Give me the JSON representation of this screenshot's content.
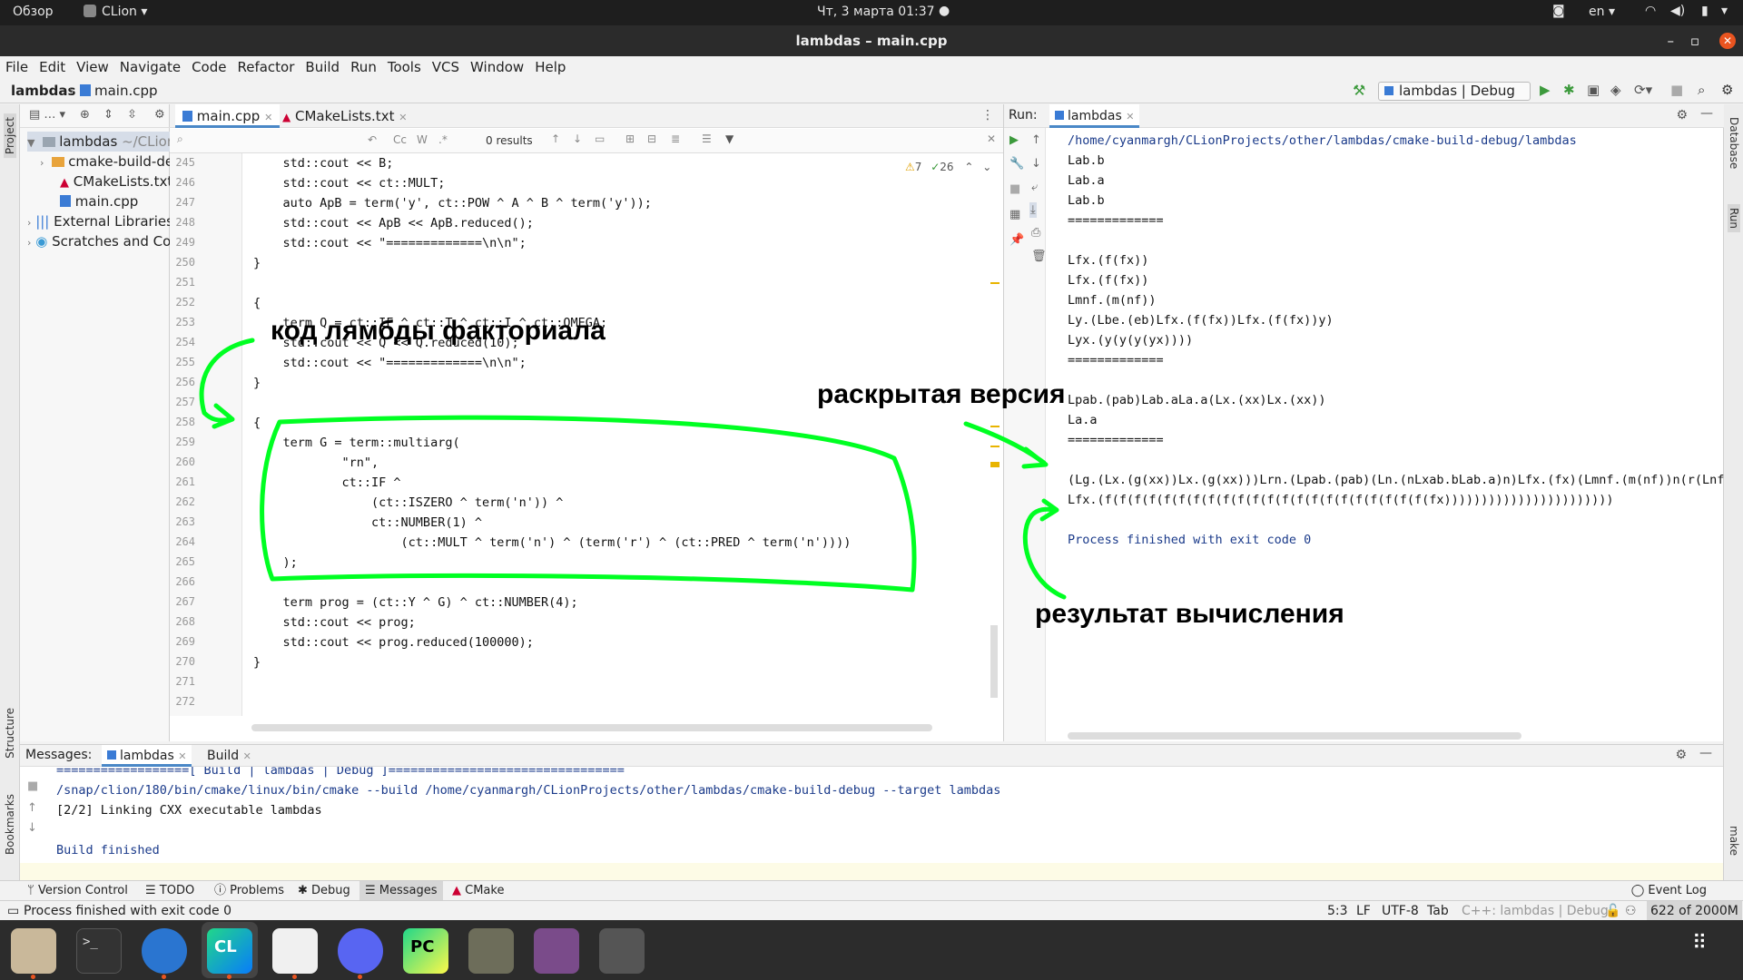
{
  "topbar": {
    "overview": "Обзор",
    "app": "CLion",
    "datetime": "Чт, 3 марта  01:37",
    "lang": "en"
  },
  "window": {
    "title": "lambdas – main.cpp"
  },
  "menu": [
    "File",
    "Edit",
    "View",
    "Navigate",
    "Code",
    "Refactor",
    "Build",
    "Run",
    "Tools",
    "VCS",
    "Window",
    "Help"
  ],
  "breadcrumb": {
    "project": "lambdas",
    "file": "main.cpp"
  },
  "run_config": "lambdas | Debug",
  "project_tree": [
    {
      "label": "lambdas",
      "suffix": "~/CLion",
      "indent": 0,
      "icon": "folder"
    },
    {
      "label": "cmake-build-de",
      "indent": 1,
      "icon": "folder-orange"
    },
    {
      "label": "CMakeLists.txt",
      "indent": 1,
      "icon": "cmake"
    },
    {
      "label": "main.cpp",
      "indent": 1,
      "icon": "cpp"
    },
    {
      "label": "External Libraries",
      "indent": 0,
      "icon": "library"
    },
    {
      "label": "Scratches and Cor",
      "indent": 0,
      "icon": "scratch"
    }
  ],
  "editor": {
    "tabs": [
      "main.cpp",
      "CMakeLists.txt"
    ],
    "search_results": "0 results",
    "warnings": "7",
    "checks": "26",
    "lines": [
      {
        "n": "245",
        "code": "    std::cout << B;"
      },
      {
        "n": "246",
        "code": "    std::cout << ct::MULT;"
      },
      {
        "n": "247",
        "code": "    auto ApB = term('y', ct::POW ^ A ^ B ^ term('y'));"
      },
      {
        "n": "248",
        "code": "    std::cout << ApB << ApB.reduced();"
      },
      {
        "n": "249",
        "code": "    std::cout << \"=============\\n\\n\";"
      },
      {
        "n": "250",
        "code": "}"
      },
      {
        "n": "251",
        "code": ""
      },
      {
        "n": "252",
        "code": "{"
      },
      {
        "n": "253",
        "code": "    term Q = ct::IF ^ ct::T ^ ct::I ^ ct::OMEGA;"
      },
      {
        "n": "254",
        "code": "    std::cout << Q << Q.reduced(10);"
      },
      {
        "n": "255",
        "code": "    std::cout << \"=============\\n\\n\";"
      },
      {
        "n": "256",
        "code": "}"
      },
      {
        "n": "257",
        "code": ""
      },
      {
        "n": "258",
        "code": "{"
      },
      {
        "n": "259",
        "code": "    term G = term::multiarg("
      },
      {
        "n": "260",
        "code": "            \"rn\","
      },
      {
        "n": "261",
        "code": "            ct::IF ^"
      },
      {
        "n": "262",
        "code": "                (ct::ISZERO ^ term('n')) ^"
      },
      {
        "n": "263",
        "code": "                ct::NUMBER(1) ^"
      },
      {
        "n": "264",
        "code": "                    (ct::MULT ^ term('n') ^ (term('r') ^ (ct::PRED ^ term('n'))))"
      },
      {
        "n": "265",
        "code": "    );"
      },
      {
        "n": "266",
        "code": ""
      },
      {
        "n": "267",
        "code": "    term prog = (ct::Y ^ G) ^ ct::NUMBER(4);"
      },
      {
        "n": "268",
        "code": "    std::cout << prog;"
      },
      {
        "n": "269",
        "code": "    std::cout << prog.reduced(100000);"
      },
      {
        "n": "270",
        "code": "}"
      },
      {
        "n": "271",
        "code": ""
      },
      {
        "n": "272",
        "code": ""
      }
    ]
  },
  "run": {
    "label": "Run:",
    "tab": "lambdas",
    "output": [
      "/home/cyanmargh/CLionProjects/other/lambdas/cmake-build-debug/lambdas",
      "Lab.b",
      "Lab.a",
      "Lab.b",
      "=============",
      "",
      "Lfx.(f(fx))",
      "Lfx.(f(fx))",
      "Lmnf.(m(nf))",
      "Ly.(Lbe.(eb)Lfx.(f(fx))Lfx.(f(fx))y)",
      "Lyx.(y(y(y(yx))))",
      "=============",
      "",
      "Lpab.(pab)Lab.aLa.a(Lx.(xx)Lx.(xx))",
      "La.a",
      "=============",
      "",
      "(Lg.(Lx.(g(xx))Lx.(g(xx)))Lrn.(Lpab.(pab)(Ln.(nLxab.bLab.a)n)Lfx.(fx)(Lmnf.(m(nf))n(r(Lnfx",
      "Lfx.(f(f(f(f(f(f(f(f(f(f(f(f(f(f(f(f(f(f(f(f(f(f(fx)))))))))))))))))))))))",
      "",
      "Process finished with exit code 0"
    ]
  },
  "messages": {
    "label": "Messages:",
    "tabs": [
      "lambdas",
      "Build"
    ],
    "lines": [
      "==================[ Build | lambdas | Debug ]================================",
      "/snap/clion/180/bin/cmake/linux/bin/cmake --build /home/cyanmargh/CLionProjects/other/lambdas/cmake-build-debug --target lambdas",
      "[2/2] Linking CXX executable lambdas",
      "",
      "Build finished"
    ]
  },
  "tool_tabs": [
    "Version Control",
    "TODO",
    "Problems",
    "Debug",
    "Messages",
    "CMake"
  ],
  "event_log": "Event Log",
  "side_labels": {
    "project": "Project",
    "structure": "Structure",
    "bookmarks": "Bookmarks",
    "database": "Database",
    "run": "Run",
    "make": "make"
  },
  "status": {
    "message": "Process finished with exit code 0",
    "position": "5:3",
    "eol": "LF",
    "encoding": "UTF-8",
    "indent": "Tab",
    "context": "C++: lambdas | Debug",
    "memory": "622 of 2000M"
  },
  "annotations": {
    "lambda_code": "код лямбды факториала",
    "expanded": "раскрытая версия",
    "result": "результат вычисления"
  },
  "colors": {
    "highlight": "#00ff22",
    "keyword": "#0033b3",
    "string": "#067d17",
    "number": "#1750eb"
  }
}
